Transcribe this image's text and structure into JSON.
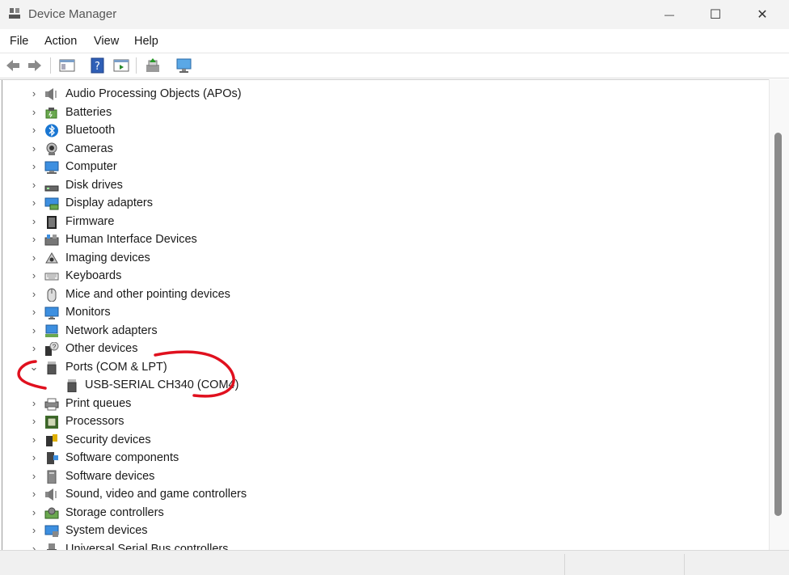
{
  "window": {
    "title": "Device Manager",
    "controls": {
      "minimize": "—",
      "maximize": "☐",
      "close": "✕"
    }
  },
  "menu": [
    "File",
    "Action",
    "View",
    "Help"
  ],
  "toolbar": [
    "back-icon",
    "forward-icon",
    "show-hide-console-tree-icon",
    "help-icon",
    "properties-icon",
    "update-driver-icon",
    "scan-hardware-icon"
  ],
  "tree": [
    {
      "label": "Audio Processing Objects (APOs)",
      "icon": "speaker-icon",
      "expanded": false
    },
    {
      "label": "Batteries",
      "icon": "battery-icon",
      "expanded": false
    },
    {
      "label": "Bluetooth",
      "icon": "bluetooth-icon",
      "expanded": false
    },
    {
      "label": "Cameras",
      "icon": "camera-icon",
      "expanded": false
    },
    {
      "label": "Computer",
      "icon": "computer-icon",
      "expanded": false
    },
    {
      "label": "Disk drives",
      "icon": "disk-drive-icon",
      "expanded": false
    },
    {
      "label": "Display adapters",
      "icon": "display-adapter-icon",
      "expanded": false
    },
    {
      "label": "Firmware",
      "icon": "firmware-icon",
      "expanded": false
    },
    {
      "label": "Human Interface Devices",
      "icon": "hid-icon",
      "expanded": false
    },
    {
      "label": "Imaging devices",
      "icon": "imaging-icon",
      "expanded": false
    },
    {
      "label": "Keyboards",
      "icon": "keyboard-icon",
      "expanded": false
    },
    {
      "label": "Mice and other pointing devices",
      "icon": "mouse-icon",
      "expanded": false
    },
    {
      "label": "Monitors",
      "icon": "monitor-icon",
      "expanded": false
    },
    {
      "label": "Network adapters",
      "icon": "network-adapter-icon",
      "expanded": false
    },
    {
      "label": "Other devices",
      "icon": "other-devices-icon",
      "expanded": false
    },
    {
      "label": "Ports (COM & LPT)",
      "icon": "port-icon",
      "expanded": true,
      "children": [
        {
          "label": "USB-SERIAL CH340 (COM4)",
          "icon": "port-icon"
        }
      ]
    },
    {
      "label": "Print queues",
      "icon": "printer-icon",
      "expanded": false
    },
    {
      "label": "Processors",
      "icon": "processor-icon",
      "expanded": false
    },
    {
      "label": "Security devices",
      "icon": "security-device-icon",
      "expanded": false
    },
    {
      "label": "Software components",
      "icon": "software-component-icon",
      "expanded": false
    },
    {
      "label": "Software devices",
      "icon": "software-device-icon",
      "expanded": false
    },
    {
      "label": "Sound, video and game controllers",
      "icon": "speaker-icon",
      "expanded": false
    },
    {
      "label": "Storage controllers",
      "icon": "storage-controller-icon",
      "expanded": false
    },
    {
      "label": "System devices",
      "icon": "system-devices-icon",
      "expanded": false
    },
    {
      "label": "Universal Serial Bus controllers",
      "icon": "usb-icon",
      "expanded": false
    }
  ],
  "annotation": {
    "color": "#e0101e"
  }
}
